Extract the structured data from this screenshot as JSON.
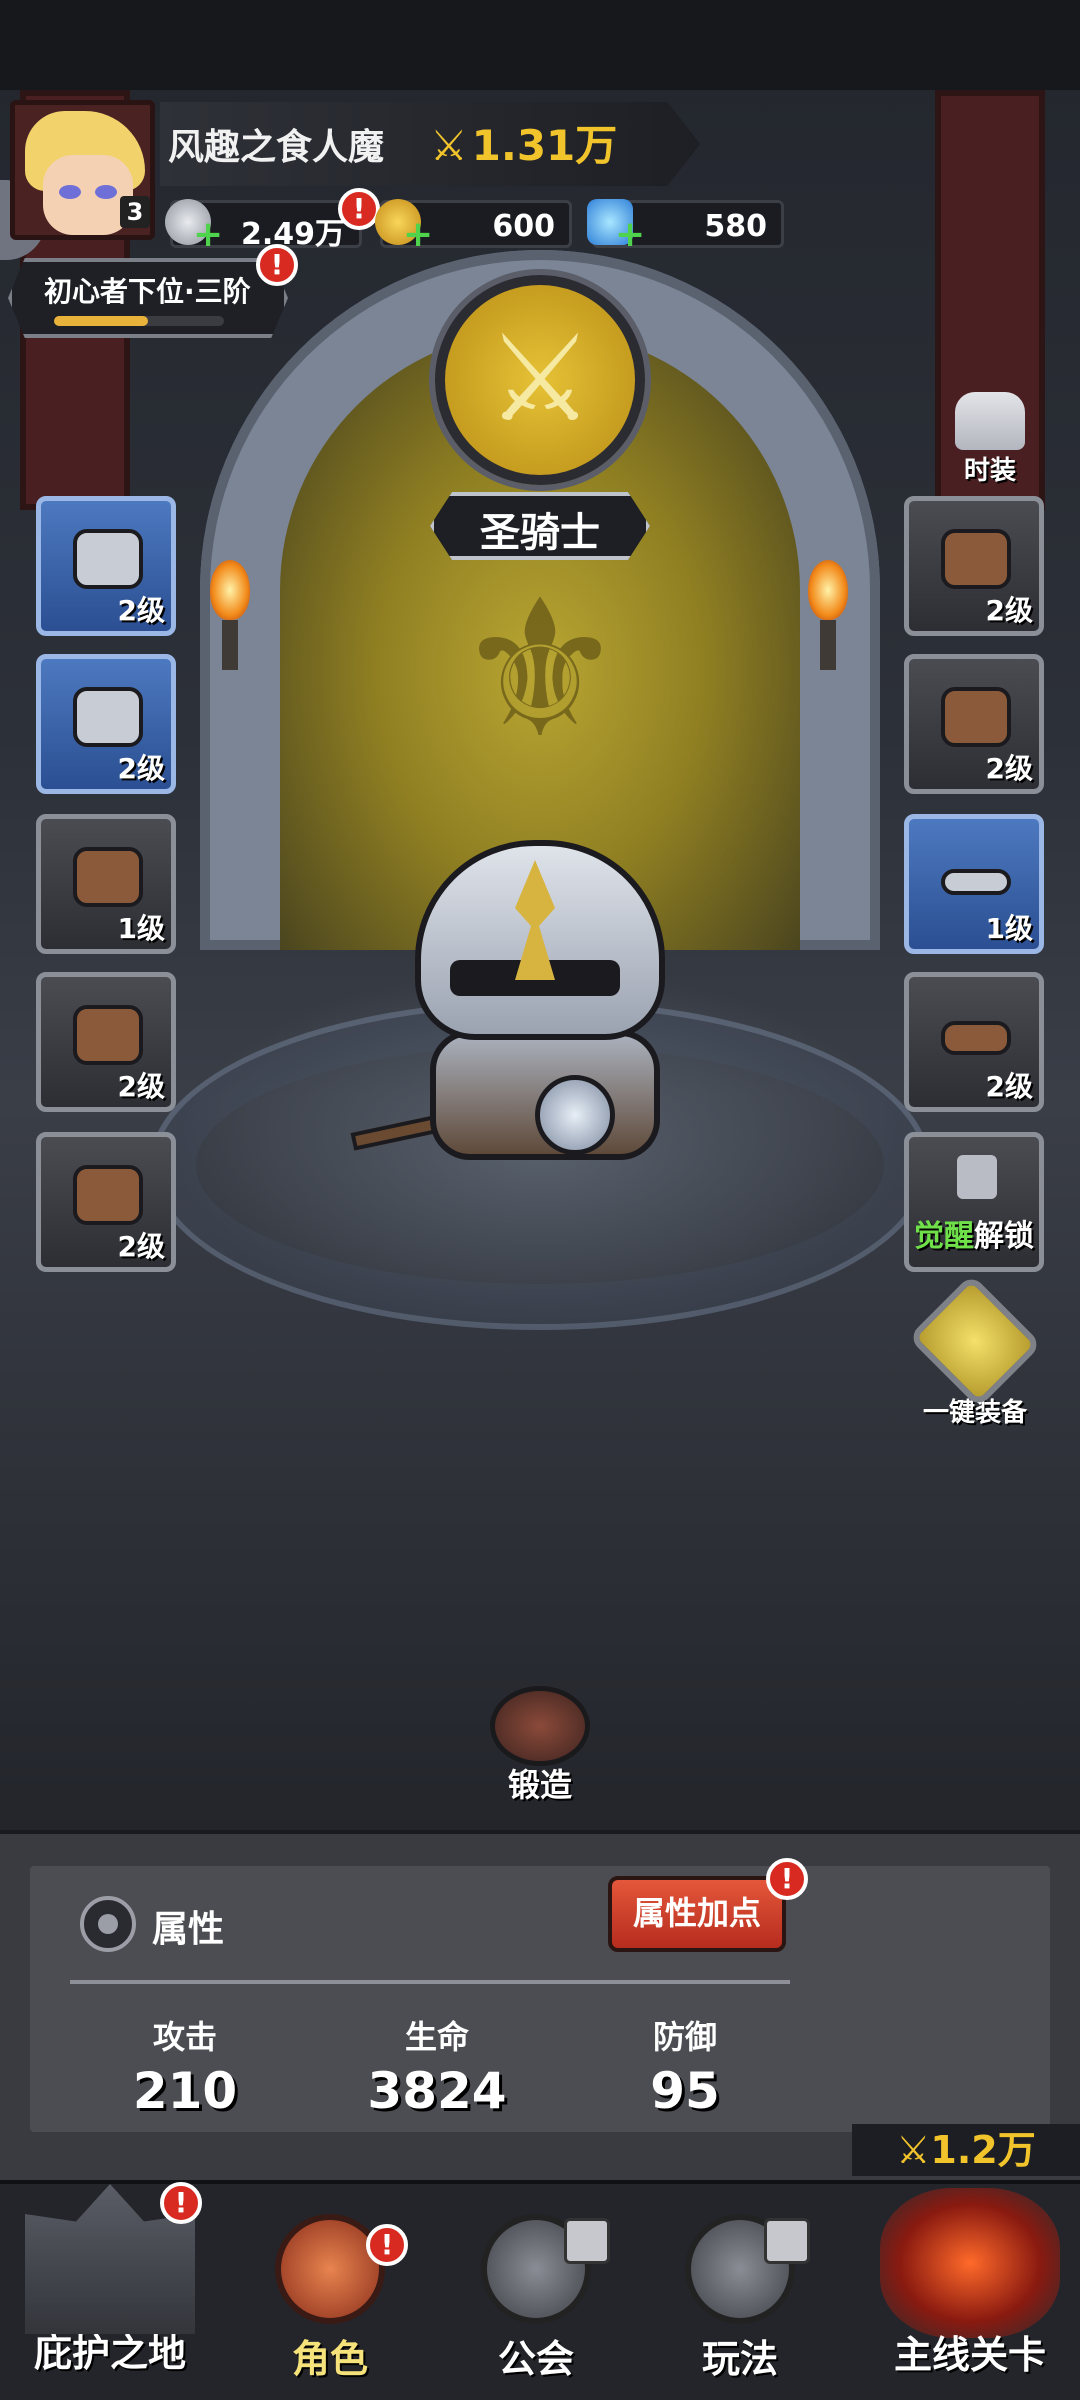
{
  "player": {
    "name": "风趣之食人魔",
    "level": "3",
    "power": "1.31万"
  },
  "resources": {
    "silver": "2.49万",
    "gold": "600",
    "gems": "580"
  },
  "rank": {
    "label": "初心者下位·三阶",
    "progress": 0.55
  },
  "character_class": {
    "name": "圣骑士"
  },
  "equipment": {
    "left": [
      {
        "level": "2级",
        "highlighted": true
      },
      {
        "level": "2级",
        "highlighted": true
      },
      {
        "level": "1级",
        "highlighted": false
      },
      {
        "level": "2级",
        "highlighted": false
      },
      {
        "level": "2级",
        "highlighted": false
      }
    ],
    "right": [
      {
        "level": "2级",
        "highlighted": false
      },
      {
        "level": "2级",
        "highlighted": false
      },
      {
        "level": "1级",
        "highlighted": true
      },
      {
        "level": "2级",
        "highlighted": false
      }
    ],
    "awaken_slot": {
      "awaken": "觉醒",
      "unlock": "解锁"
    }
  },
  "side_buttons": {
    "costume": "时装",
    "auto_equip": "一键装备",
    "forge": "锻造"
  },
  "attributes": {
    "title": "属性",
    "add_points": "属性加点",
    "stats": [
      {
        "label": "攻击",
        "value": "210"
      },
      {
        "label": "生命",
        "value": "3824"
      },
      {
        "label": "防御",
        "value": "95"
      }
    ]
  },
  "bottom_power": "1.2万",
  "nav": {
    "shelter": "庇护之地",
    "character": "角色",
    "guild": "公会",
    "gameplay": "玩法",
    "main_stage": "主线关卡"
  },
  "alert_mark": "!",
  "sword_glyph": "⚔",
  "colors": {
    "gold_text": "#f2c42c",
    "alert_red": "#d82a21",
    "slot_blue": "#3a64ac",
    "awaken_green": "#6fe04a"
  }
}
